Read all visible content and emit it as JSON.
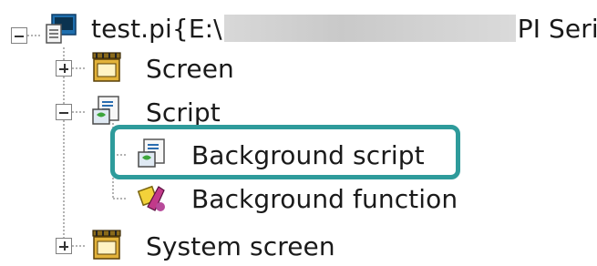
{
  "tree": {
    "root": {
      "label_prefix": "test.pi{E:\\",
      "label_suffix": "PI Serie",
      "icon": "project-file-icon",
      "expanded": true
    },
    "items": [
      {
        "label": "Screen",
        "icon": "screen-folder-icon",
        "expanded": false
      },
      {
        "label": "Script",
        "icon": "script-folder-icon",
        "expanded": true,
        "children": [
          {
            "label": "Background script",
            "icon": "background-script-icon",
            "highlighted": true
          },
          {
            "label": "Background function",
            "icon": "background-function-icon"
          }
        ]
      },
      {
        "label": "System screen",
        "icon": "system-screen-folder-icon",
        "expanded": false
      }
    ]
  },
  "colors": {
    "highlight_border": "#2e9b9b",
    "tree_line": "#9a9a9a"
  }
}
